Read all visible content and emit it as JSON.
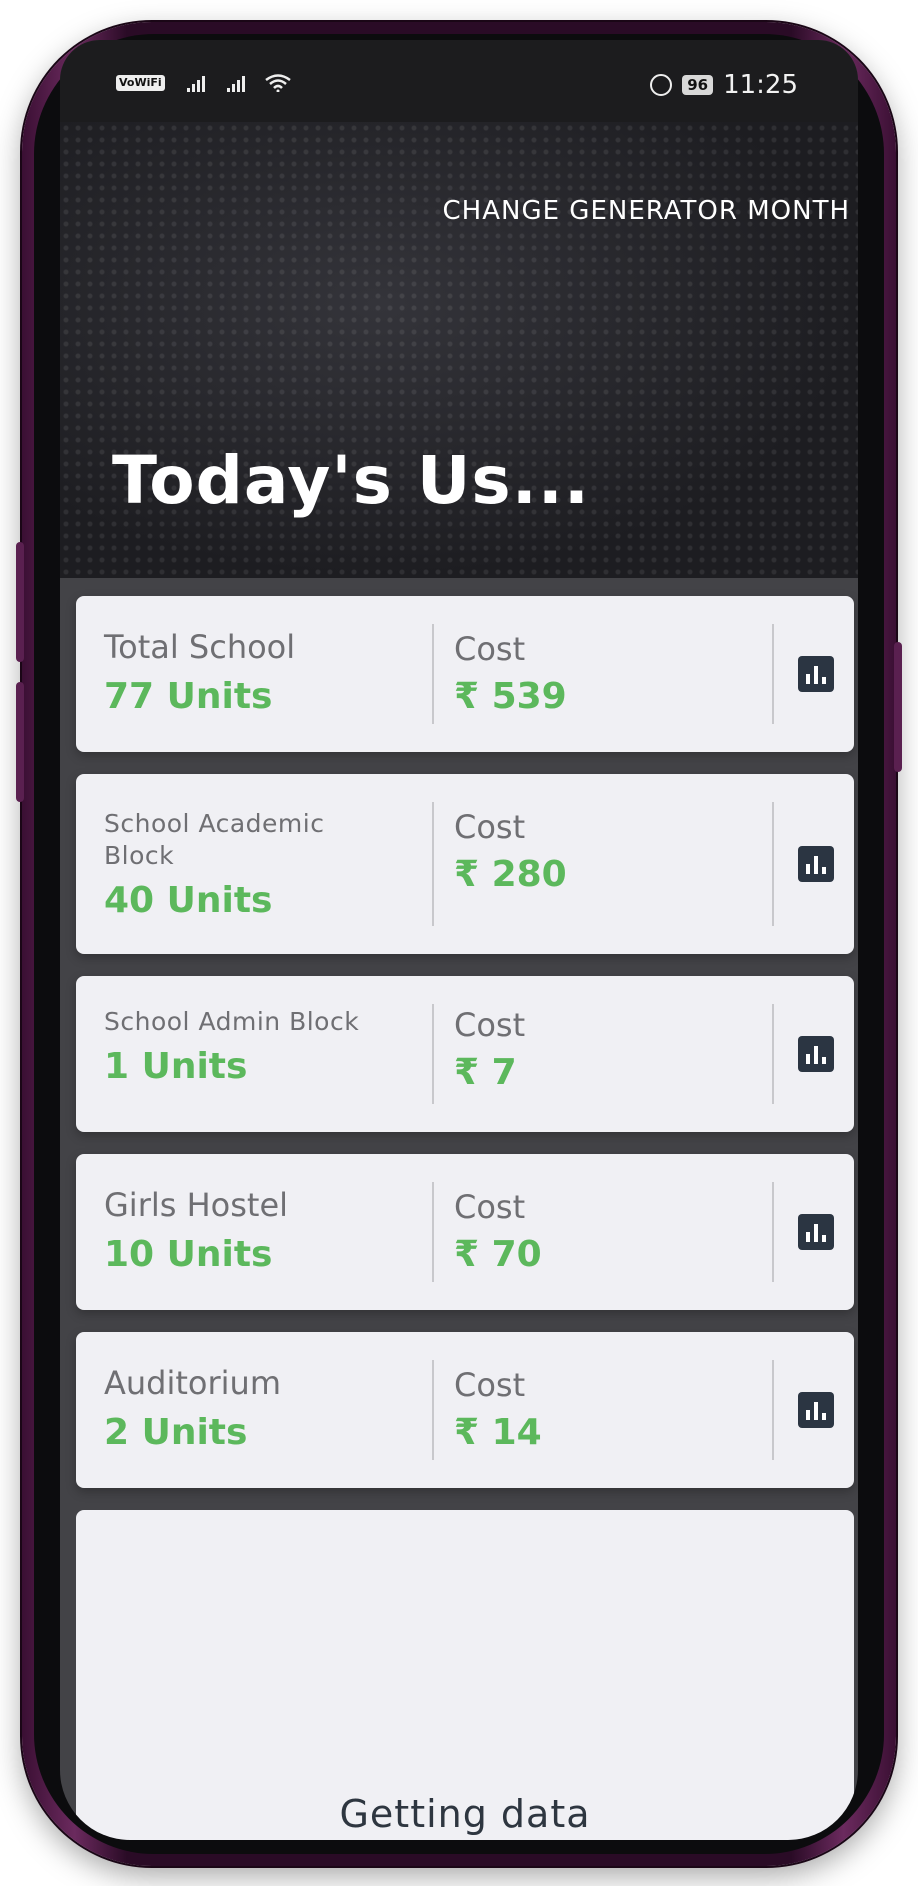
{
  "status_bar": {
    "vowifi": "VoWiFi",
    "battery": "96",
    "time": "11:25"
  },
  "header": {
    "action": "CHANGE GENERATOR MONTH",
    "title": "Today's Us..."
  },
  "cards": [
    {
      "name": "Total School",
      "units": "77 Units",
      "cost_label": "Cost",
      "cost": "₹ 539"
    },
    {
      "name": "School Academic Block",
      "units": "40 Units",
      "cost_label": "Cost",
      "cost": "₹ 280"
    },
    {
      "name": "School Admin Block",
      "units": "1 Units",
      "cost_label": "Cost",
      "cost": "₹ 7"
    },
    {
      "name": "Girls Hostel",
      "units": "10 Units",
      "cost_label": "Cost",
      "cost": "₹ 70"
    },
    {
      "name": "Auditorium",
      "units": "2 Units",
      "cost_label": "Cost",
      "cost": "₹ 14"
    }
  ],
  "loading": {
    "text": "Getting data"
  },
  "colors": {
    "accent_green": "#5cb85c",
    "header_dark": "#1d1d21",
    "card_bg": "#f0f0f4",
    "icon_dark": "#2b3542"
  },
  "icons": {
    "chart": "bar-chart-icon",
    "alarm": "alarm-icon",
    "wifi": "wifi-icon",
    "signal": "signal-icon"
  }
}
